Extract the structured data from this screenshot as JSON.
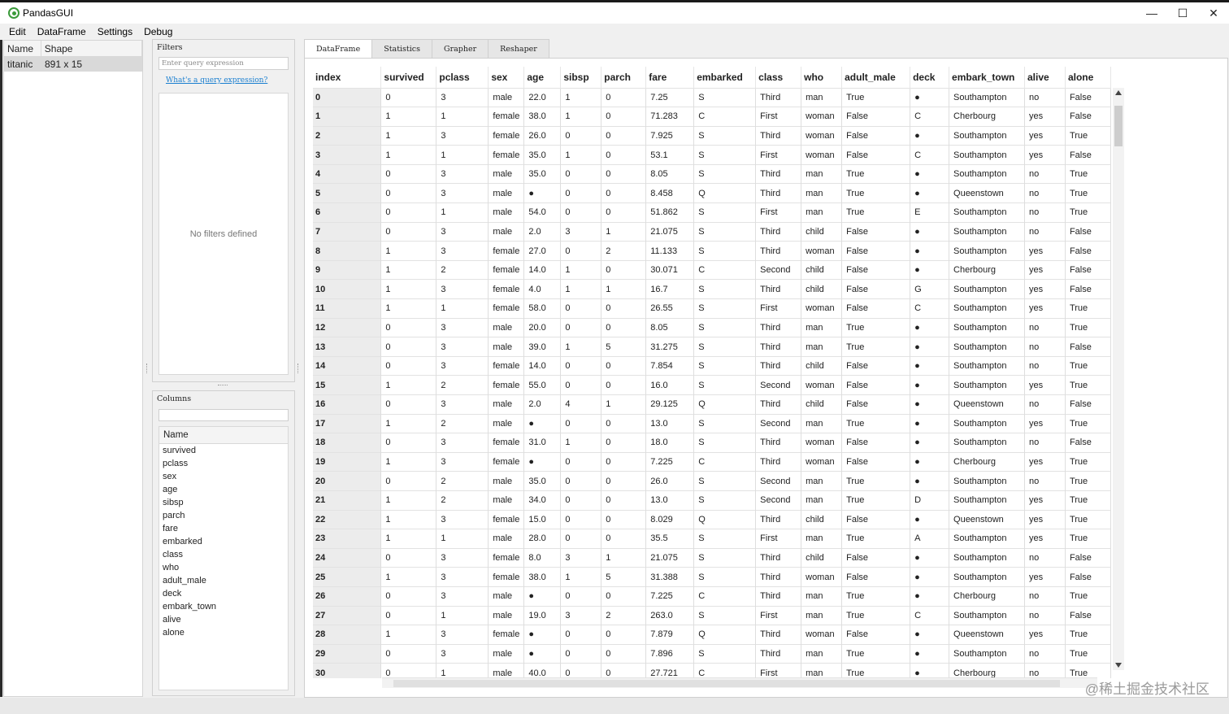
{
  "window": {
    "title": "PandasGUI",
    "minimize": "—",
    "maximize": "☐",
    "close": "✕"
  },
  "menu": [
    "Edit",
    "DataFrame",
    "Settings",
    "Debug"
  ],
  "datasets": {
    "headers": [
      "Name",
      "Shape"
    ],
    "rows": [
      {
        "name": "titanic",
        "shape": "891 x 15"
      }
    ]
  },
  "filters": {
    "title": "Filters",
    "placeholder": "Enter query expression",
    "help_link": "What's a query expression?",
    "empty_text": "No filters defined"
  },
  "columns_panel": {
    "title": "Columns",
    "header": "Name",
    "items": [
      "survived",
      "pclass",
      "sex",
      "age",
      "sibsp",
      "parch",
      "fare",
      "embarked",
      "class",
      "who",
      "adult_male",
      "deck",
      "embark_town",
      "alive",
      "alone"
    ]
  },
  "tabs": [
    "DataFrame",
    "Statistics",
    "Grapher",
    "Reshaper"
  ],
  "table": {
    "columns": [
      "index",
      "survived",
      "pclass",
      "sex",
      "age",
      "sibsp",
      "parch",
      "fare",
      "embarked",
      "class",
      "who",
      "adult_male",
      "deck",
      "embark_town",
      "alive",
      "alone"
    ],
    "rows": [
      [
        "0",
        "0",
        "3",
        "male",
        "22.0",
        "1",
        "0",
        "7.25",
        "S",
        "Third",
        "man",
        "True",
        "●",
        "Southampton",
        "no",
        "False"
      ],
      [
        "1",
        "1",
        "1",
        "female",
        "38.0",
        "1",
        "0",
        "71.283",
        "C",
        "First",
        "woman",
        "False",
        "C",
        "Cherbourg",
        "yes",
        "False"
      ],
      [
        "2",
        "1",
        "3",
        "female",
        "26.0",
        "0",
        "0",
        "7.925",
        "S",
        "Third",
        "woman",
        "False",
        "●",
        "Southampton",
        "yes",
        "True"
      ],
      [
        "3",
        "1",
        "1",
        "female",
        "35.0",
        "1",
        "0",
        "53.1",
        "S",
        "First",
        "woman",
        "False",
        "C",
        "Southampton",
        "yes",
        "False"
      ],
      [
        "4",
        "0",
        "3",
        "male",
        "35.0",
        "0",
        "0",
        "8.05",
        "S",
        "Third",
        "man",
        "True",
        "●",
        "Southampton",
        "no",
        "True"
      ],
      [
        "5",
        "0",
        "3",
        "male",
        "●",
        "0",
        "0",
        "8.458",
        "Q",
        "Third",
        "man",
        "True",
        "●",
        "Queenstown",
        "no",
        "True"
      ],
      [
        "6",
        "0",
        "1",
        "male",
        "54.0",
        "0",
        "0",
        "51.862",
        "S",
        "First",
        "man",
        "True",
        "E",
        "Southampton",
        "no",
        "True"
      ],
      [
        "7",
        "0",
        "3",
        "male",
        "2.0",
        "3",
        "1",
        "21.075",
        "S",
        "Third",
        "child",
        "False",
        "●",
        "Southampton",
        "no",
        "False"
      ],
      [
        "8",
        "1",
        "3",
        "female",
        "27.0",
        "0",
        "2",
        "11.133",
        "S",
        "Third",
        "woman",
        "False",
        "●",
        "Southampton",
        "yes",
        "False"
      ],
      [
        "9",
        "1",
        "2",
        "female",
        "14.0",
        "1",
        "0",
        "30.071",
        "C",
        "Second",
        "child",
        "False",
        "●",
        "Cherbourg",
        "yes",
        "False"
      ],
      [
        "10",
        "1",
        "3",
        "female",
        "4.0",
        "1",
        "1",
        "16.7",
        "S",
        "Third",
        "child",
        "False",
        "G",
        "Southampton",
        "yes",
        "False"
      ],
      [
        "11",
        "1",
        "1",
        "female",
        "58.0",
        "0",
        "0",
        "26.55",
        "S",
        "First",
        "woman",
        "False",
        "C",
        "Southampton",
        "yes",
        "True"
      ],
      [
        "12",
        "0",
        "3",
        "male",
        "20.0",
        "0",
        "0",
        "8.05",
        "S",
        "Third",
        "man",
        "True",
        "●",
        "Southampton",
        "no",
        "True"
      ],
      [
        "13",
        "0",
        "3",
        "male",
        "39.0",
        "1",
        "5",
        "31.275",
        "S",
        "Third",
        "man",
        "True",
        "●",
        "Southampton",
        "no",
        "False"
      ],
      [
        "14",
        "0",
        "3",
        "female",
        "14.0",
        "0",
        "0",
        "7.854",
        "S",
        "Third",
        "child",
        "False",
        "●",
        "Southampton",
        "no",
        "True"
      ],
      [
        "15",
        "1",
        "2",
        "female",
        "55.0",
        "0",
        "0",
        "16.0",
        "S",
        "Second",
        "woman",
        "False",
        "●",
        "Southampton",
        "yes",
        "True"
      ],
      [
        "16",
        "0",
        "3",
        "male",
        "2.0",
        "4",
        "1",
        "29.125",
        "Q",
        "Third",
        "child",
        "False",
        "●",
        "Queenstown",
        "no",
        "False"
      ],
      [
        "17",
        "1",
        "2",
        "male",
        "●",
        "0",
        "0",
        "13.0",
        "S",
        "Second",
        "man",
        "True",
        "●",
        "Southampton",
        "yes",
        "True"
      ],
      [
        "18",
        "0",
        "3",
        "female",
        "31.0",
        "1",
        "0",
        "18.0",
        "S",
        "Third",
        "woman",
        "False",
        "●",
        "Southampton",
        "no",
        "False"
      ],
      [
        "19",
        "1",
        "3",
        "female",
        "●",
        "0",
        "0",
        "7.225",
        "C",
        "Third",
        "woman",
        "False",
        "●",
        "Cherbourg",
        "yes",
        "True"
      ],
      [
        "20",
        "0",
        "2",
        "male",
        "35.0",
        "0",
        "0",
        "26.0",
        "S",
        "Second",
        "man",
        "True",
        "●",
        "Southampton",
        "no",
        "True"
      ],
      [
        "21",
        "1",
        "2",
        "male",
        "34.0",
        "0",
        "0",
        "13.0",
        "S",
        "Second",
        "man",
        "True",
        "D",
        "Southampton",
        "yes",
        "True"
      ],
      [
        "22",
        "1",
        "3",
        "female",
        "15.0",
        "0",
        "0",
        "8.029",
        "Q",
        "Third",
        "child",
        "False",
        "●",
        "Queenstown",
        "yes",
        "True"
      ],
      [
        "23",
        "1",
        "1",
        "male",
        "28.0",
        "0",
        "0",
        "35.5",
        "S",
        "First",
        "man",
        "True",
        "A",
        "Southampton",
        "yes",
        "True"
      ],
      [
        "24",
        "0",
        "3",
        "female",
        "8.0",
        "3",
        "1",
        "21.075",
        "S",
        "Third",
        "child",
        "False",
        "●",
        "Southampton",
        "no",
        "False"
      ],
      [
        "25",
        "1",
        "3",
        "female",
        "38.0",
        "1",
        "5",
        "31.388",
        "S",
        "Third",
        "woman",
        "False",
        "●",
        "Southampton",
        "yes",
        "False"
      ],
      [
        "26",
        "0",
        "3",
        "male",
        "●",
        "0",
        "0",
        "7.225",
        "C",
        "Third",
        "man",
        "True",
        "●",
        "Cherbourg",
        "no",
        "True"
      ],
      [
        "27",
        "0",
        "1",
        "male",
        "19.0",
        "3",
        "2",
        "263.0",
        "S",
        "First",
        "man",
        "True",
        "C",
        "Southampton",
        "no",
        "False"
      ],
      [
        "28",
        "1",
        "3",
        "female",
        "●",
        "0",
        "0",
        "7.879",
        "Q",
        "Third",
        "woman",
        "False",
        "●",
        "Queenstown",
        "yes",
        "True"
      ],
      [
        "29",
        "0",
        "3",
        "male",
        "●",
        "0",
        "0",
        "7.896",
        "S",
        "Third",
        "man",
        "True",
        "●",
        "Southampton",
        "no",
        "True"
      ],
      [
        "30",
        "0",
        "1",
        "male",
        "40.0",
        "0",
        "0",
        "27.721",
        "C",
        "First",
        "man",
        "True",
        "●",
        "Cherbourg",
        "no",
        "True"
      ]
    ]
  },
  "watermark": "@稀土掘金技术社区",
  "colors": {
    "accent_link": "#1a7fd0",
    "app_icon": "#3a9a3a",
    "index_bg": "#ececec"
  }
}
